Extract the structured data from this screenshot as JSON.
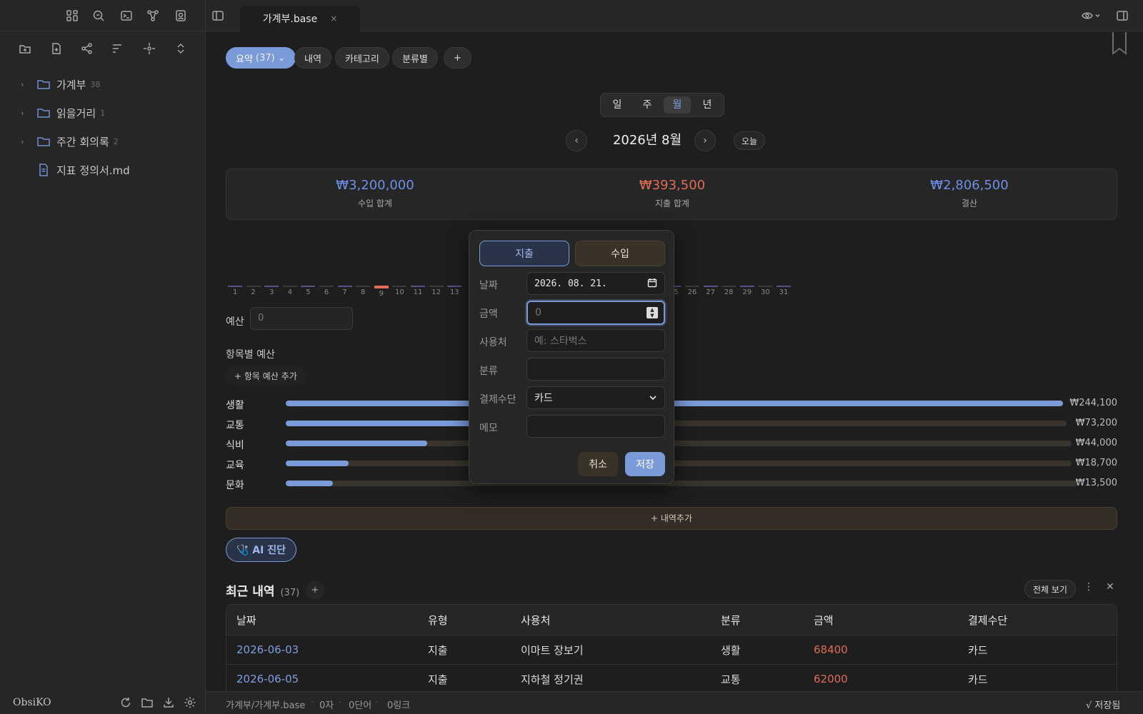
{
  "colors": {
    "accent": "#7b9ad8",
    "income": "#6f8fe8",
    "expense": "#e06c5a",
    "net": "#6f8fe8"
  },
  "sidebar": {
    "top_icons": [
      "layout-icon",
      "search-icon",
      "terminal-icon",
      "graph-icon",
      "profile-icon"
    ],
    "toolbar_icons": [
      "new-folder-icon",
      "new-note-icon",
      "graph-nodes-icon",
      "sort-icon",
      "focus-icon",
      "collapse-icon"
    ],
    "tree": [
      {
        "name": "가계부",
        "count": "38",
        "type": "folder"
      },
      {
        "name": "읽을거리",
        "count": "1",
        "type": "folder"
      },
      {
        "name": "주간 회의록",
        "count": "2",
        "type": "folder"
      },
      {
        "name": "지표 정의서.md",
        "count": "",
        "type": "file"
      }
    ],
    "vault_name": "ObsiKO"
  },
  "tab": {
    "title": "가계부.base",
    "close": "×"
  },
  "views": [
    {
      "label": "요약",
      "sub": "(37) ⌄",
      "active": true
    },
    {
      "label": "내역",
      "sub": ""
    },
    {
      "label": "카테고리",
      "sub": ""
    },
    {
      "label": "분류별",
      "sub": ""
    },
    {
      "label": "+",
      "sub": ""
    }
  ],
  "period_seg": [
    "일",
    "주",
    "월",
    "년"
  ],
  "period_selected": "월",
  "nav": {
    "prev": "‹",
    "next": "›",
    "period": "2026년 8월",
    "today": "오늘"
  },
  "summary": {
    "income": {
      "value": "₩3,200,000",
      "label": "수입 합계"
    },
    "expense": {
      "value": "₩393,500",
      "label": "지출 합계"
    },
    "net": {
      "value": "₩2,806,500",
      "label": "결산"
    }
  },
  "days_visible": [
    "1",
    "2",
    "3",
    "4",
    "5",
    "6",
    "7",
    "8",
    "9",
    "10",
    "11",
    "12",
    "13",
    "25",
    "26",
    "27",
    "28",
    "29",
    "30",
    "31"
  ],
  "budget": {
    "label": "예산",
    "placeholder": "0",
    "section": "항목별 예산",
    "add": "+ 항목 예산 추가"
  },
  "categories": [
    {
      "name": "생활",
      "amount": "₩244,100",
      "ratio": 1.0
    },
    {
      "name": "교통",
      "amount": "₩73,200",
      "ratio": 0.3
    },
    {
      "name": "식비",
      "amount": "₩44,000",
      "ratio": 0.18
    },
    {
      "name": "교육",
      "amount": "₩18,700",
      "ratio": 0.08
    },
    {
      "name": "문화",
      "amount": "₩13,500",
      "ratio": 0.06
    }
  ],
  "add_entry": "+ 내역추가",
  "ai_button": "🩺 AI 진단",
  "recent": {
    "title": "최근 내역",
    "count": "(37)",
    "plus": "+",
    "view_all": "전체 보기",
    "more": "⋮",
    "close": "✕",
    "columns": [
      "날짜",
      "유형",
      "사용처",
      "분류",
      "금액",
      "결제수단"
    ],
    "rows": [
      [
        "2026-06-03",
        "지출",
        "이마트 장보기",
        "생활",
        "68400",
        "카드"
      ],
      [
        "2026-06-05",
        "지출",
        "지하철 정기권",
        "교통",
        "62000",
        "카드"
      ]
    ]
  },
  "status": {
    "path": "가계부/가계부.base",
    "chars": "0자",
    "words": "0단어",
    "links": "0링크",
    "saved": "√ 저장됨"
  },
  "modal": {
    "type_expense": "지출",
    "type_income": "수입",
    "date_label": "날짜",
    "date_value": "2026. 08. 21.",
    "amount_label": "금액",
    "amount_placeholder": "0",
    "payee_label": "사용처",
    "payee_placeholder": "예: 스타벅스",
    "category_label": "분류",
    "category_value": "",
    "method_label": "결제수단",
    "method_value": "카드",
    "memo_label": "메모",
    "memo_value": "",
    "cancel": "취소",
    "save": "저장"
  }
}
